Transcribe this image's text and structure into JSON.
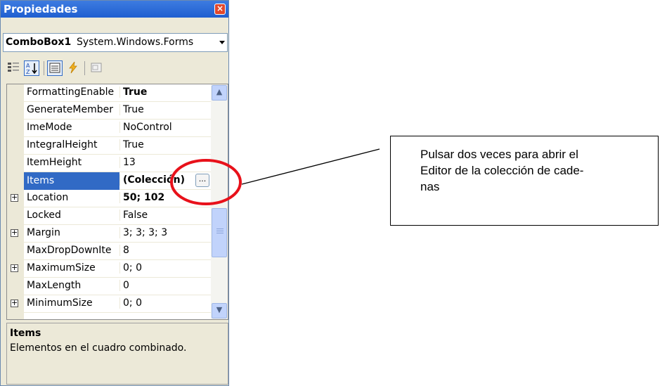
{
  "window": {
    "title": "Propiedades"
  },
  "object_selector": {
    "name": "ComboBox1",
    "type": "System.Windows.Forms"
  },
  "toolbar": {
    "icons": [
      "categorized-icon",
      "alphabetical-icon",
      "properties-icon",
      "events-icon",
      "property-pages-icon"
    ]
  },
  "properties": [
    {
      "name": "FormattingEnable",
      "value": "True",
      "bold": true,
      "expand": false
    },
    {
      "name": "GenerateMember",
      "value": "True",
      "bold": false,
      "expand": false
    },
    {
      "name": "ImeMode",
      "value": "NoControl",
      "bold": false,
      "expand": false
    },
    {
      "name": "IntegralHeight",
      "value": "True",
      "bold": false,
      "expand": false
    },
    {
      "name": "ItemHeight",
      "value": "13",
      "bold": false,
      "expand": false
    },
    {
      "name": "Items",
      "value": "(Colección)",
      "bold": true,
      "expand": false,
      "selected": true,
      "ellipsis": "..."
    },
    {
      "name": "Location",
      "value": "50; 102",
      "bold": true,
      "expand": true
    },
    {
      "name": "Locked",
      "value": "False",
      "bold": false,
      "expand": false
    },
    {
      "name": "Margin",
      "value": "3; 3; 3; 3",
      "bold": false,
      "expand": true
    },
    {
      "name": "MaxDropDownIte",
      "value": "8",
      "bold": false,
      "expand": false
    },
    {
      "name": "MaximumSize",
      "value": "0; 0",
      "bold": false,
      "expand": true
    },
    {
      "name": "MaxLength",
      "value": "0",
      "bold": false,
      "expand": false
    },
    {
      "name": "MinimumSize",
      "value": "0; 0",
      "bold": false,
      "expand": true
    }
  ],
  "description": {
    "title": "Items",
    "text": "Elementos en el cuadro combinado."
  },
  "callout": {
    "lines": [
      "Pulsar dos veces para abrir el",
      "Editor de la colección de cade-",
      "nas"
    ]
  },
  "colors": {
    "highlight_circle": "#e8111a",
    "selection": "#316ac5",
    "titlebar": "#2a66d6"
  }
}
